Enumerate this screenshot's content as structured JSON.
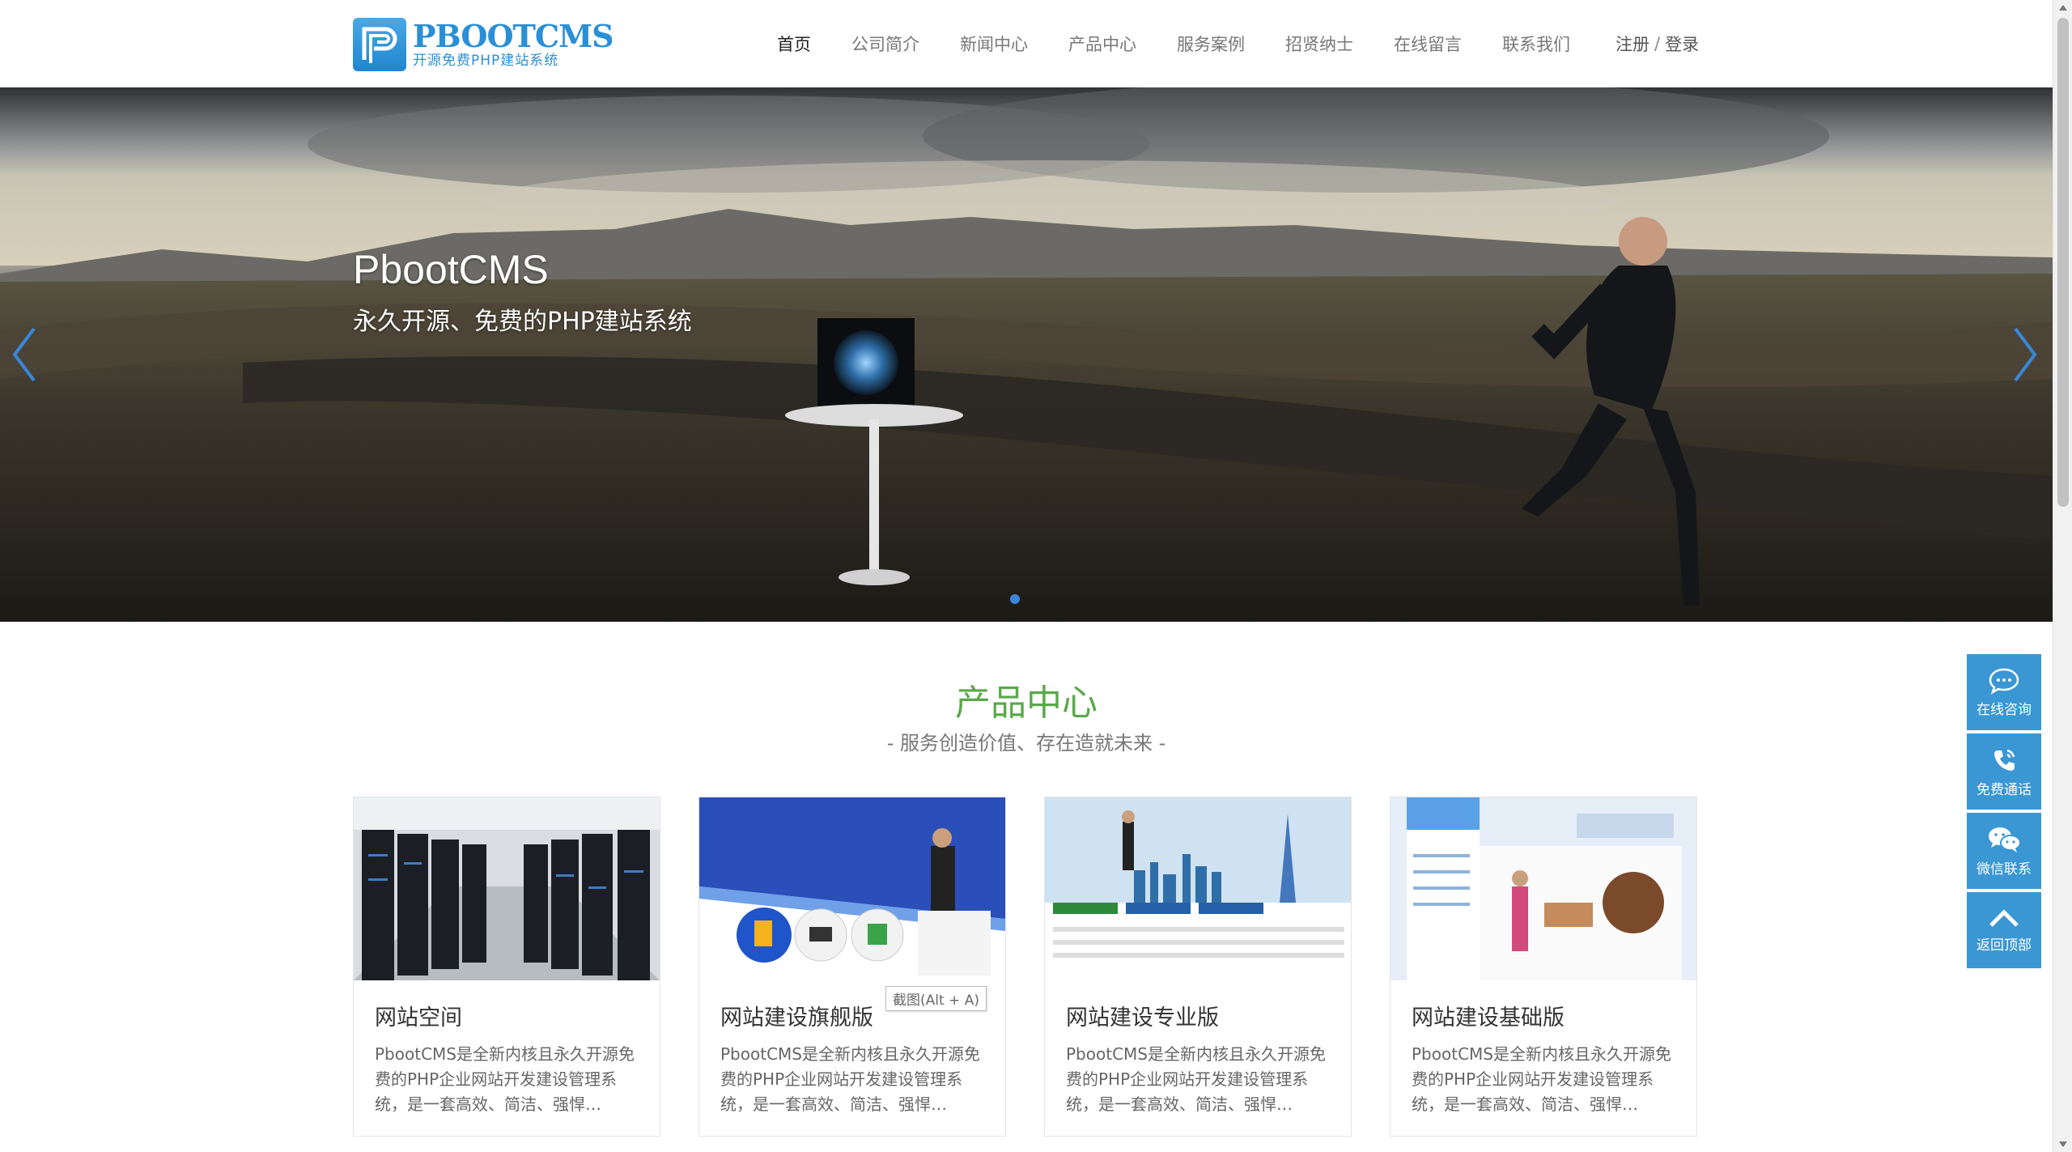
{
  "logo": {
    "title": "PBOOTCMS",
    "subtitle": "开源免费PHP建站系统"
  },
  "nav": {
    "items": [
      "首页",
      "公司简介",
      "新闻中心",
      "产品中心",
      "服务案例",
      "招贤纳士",
      "在线留言",
      "联系我们"
    ],
    "active_index": 0
  },
  "auth": {
    "register": "注册",
    "separator": "/",
    "login": "登录"
  },
  "banner": {
    "title": "PbootCMS",
    "subtitle": "永久开源、免费的PHP建站系统",
    "slide_count": 1,
    "active_slide": 1
  },
  "section": {
    "title": "产品中心",
    "subtitle": "- 服务创造价值、存在造就未来 -"
  },
  "products": [
    {
      "name": "网站空间",
      "desc": "PbootCMS是全新内核且永久开源免费的PHP企业网站开发建设管理系统，是一套高效、简洁、强悍…"
    },
    {
      "name": "网站建设旗舰版",
      "desc": "PbootCMS是全新内核且永久开源免费的PHP企业网站开发建设管理系统，是一套高效、简洁、强悍…"
    },
    {
      "name": "网站建设专业版",
      "desc": "PbootCMS是全新内核且永久开源免费的PHP企业网站开发建设管理系统，是一套高效、简洁、强悍…"
    },
    {
      "name": "网站建设基础版",
      "desc": "PbootCMS是全新内核且永久开源免费的PHP企业网站开发建设管理系统，是一套高效、简洁、强悍…"
    }
  ],
  "tooltip": "截图(Alt + A)",
  "float_bar": [
    {
      "label": "在线咨询",
      "icon": "chat-bubble-icon"
    },
    {
      "label": "免费通话",
      "icon": "phone-icon"
    },
    {
      "label": "微信联系",
      "icon": "wechat-icon"
    },
    {
      "label": "返回顶部",
      "icon": "chevron-up-icon"
    }
  ],
  "colors": {
    "accent": "#3a97d4",
    "section_title": "#5aa84a",
    "logo": "#2a8fd6"
  }
}
